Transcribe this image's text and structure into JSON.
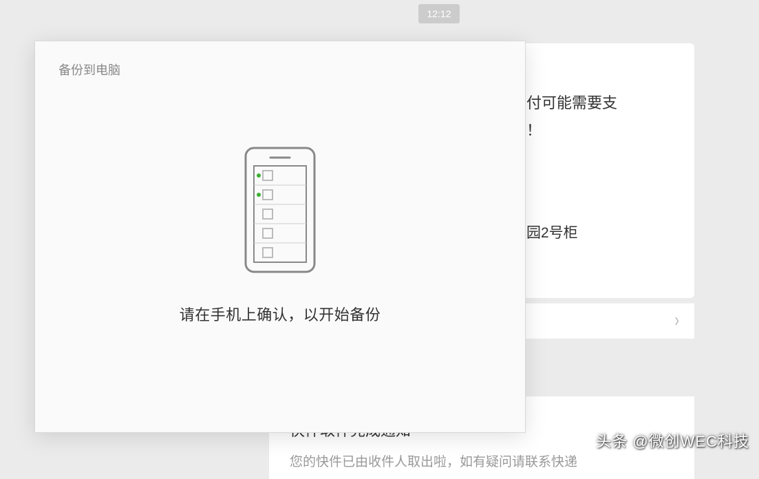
{
  "timestamp": "12:12",
  "background": {
    "text_fragment_1_line1": "付可能需要支",
    "text_fragment_1_line2": "！",
    "text_fragment_2": "园2号柜",
    "notification": {
      "title": "快件取件完成通知",
      "subtitle": "您的快件已由收件人取出啦，如有疑问请联系快递"
    }
  },
  "dialog": {
    "title": "备份到电脑",
    "message": "请在手机上确认，以开始备份"
  },
  "watermark": "头条 @微创WEC科技"
}
